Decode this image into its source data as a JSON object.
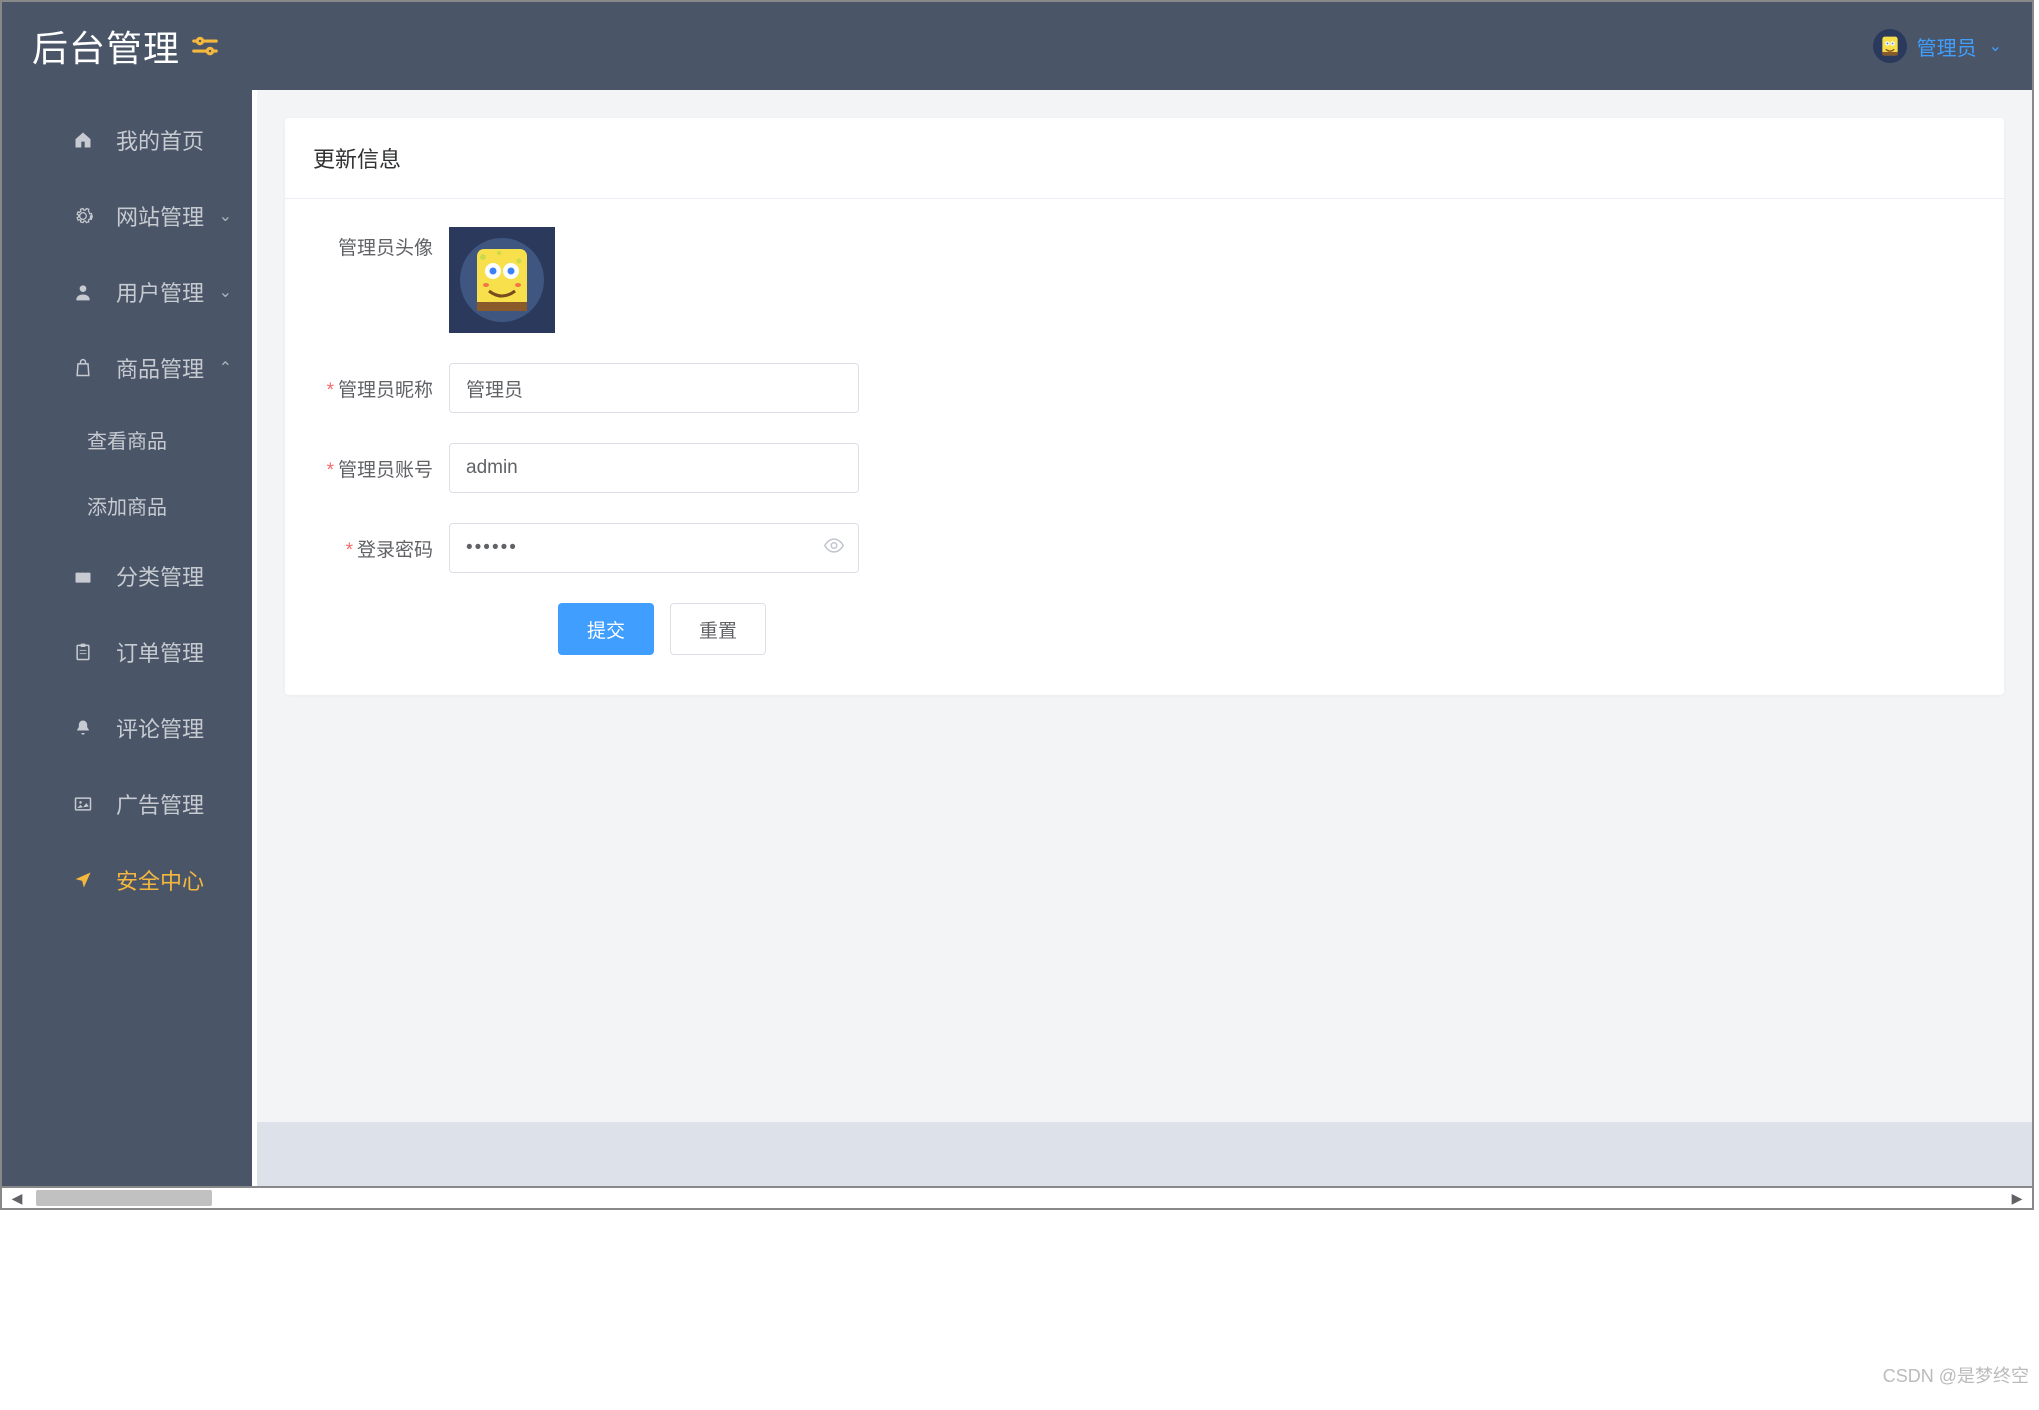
{
  "header": {
    "brand": "后台管理",
    "user_label": "管理员"
  },
  "sidebar": {
    "items": [
      {
        "label": "我的首页",
        "icon": "home",
        "expandable": false,
        "active": false
      },
      {
        "label": "网站管理",
        "icon": "gear",
        "expandable": true,
        "active": false,
        "arrow": "down"
      },
      {
        "label": "用户管理",
        "icon": "user",
        "expandable": true,
        "active": false,
        "arrow": "down"
      },
      {
        "label": "商品管理",
        "icon": "bag",
        "expandable": true,
        "active": false,
        "arrow": "up",
        "children": [
          {
            "label": "查看商品"
          },
          {
            "label": "添加商品"
          }
        ]
      },
      {
        "label": "分类管理",
        "icon": "briefcase",
        "expandable": false,
        "active": false
      },
      {
        "label": "订单管理",
        "icon": "clipboard",
        "expandable": false,
        "active": false
      },
      {
        "label": "评论管理",
        "icon": "bell",
        "expandable": false,
        "active": false
      },
      {
        "label": "广告管理",
        "icon": "image",
        "expandable": false,
        "active": false
      },
      {
        "label": "安全中心",
        "icon": "send",
        "expandable": false,
        "active": true
      }
    ]
  },
  "card": {
    "title": "更新信息",
    "form": {
      "avatar_label": "管理员头像",
      "nickname_label": "管理员昵称",
      "nickname_value": "管理员",
      "account_label": "管理员账号",
      "account_value": "admin",
      "password_label": "登录密码",
      "password_value": "••••••",
      "submit_label": "提交",
      "reset_label": "重置"
    }
  },
  "watermark": "CSDN @是梦终空"
}
